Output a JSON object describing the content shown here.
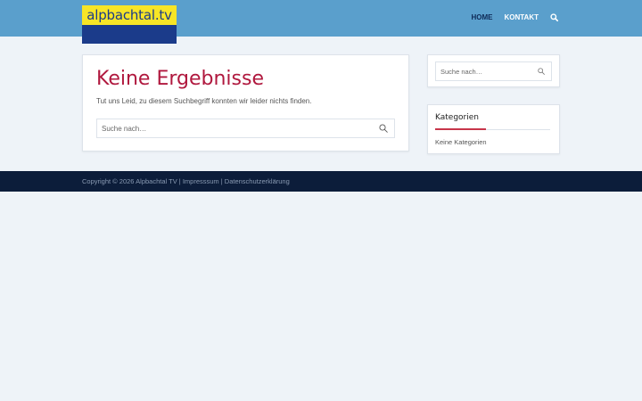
{
  "logo": {
    "text": "alpbachtal.tv"
  },
  "nav": {
    "home": "HOME",
    "kontakt": "KONTAKT"
  },
  "main": {
    "title": "Keine Ergebnisse",
    "description": "Tut uns Leid, zu diesem Suchbegriff konnten wir leider nichts finden.",
    "search_placeholder": "Suche nach…"
  },
  "sidebar": {
    "search_placeholder": "Suche nach…",
    "categories_title": "Kategorien",
    "categories_empty": "Keine Kategorien"
  },
  "footer": {
    "copyright": "Copyright © 2026 Alpbachtal TV",
    "sep1": " | ",
    "impressum": "Impresssum",
    "sep2": " | ",
    "datenschutz": "Datenschutzerklärung"
  },
  "colors": {
    "header": "#5a9fcc",
    "logo_yellow": "#f7e526",
    "logo_blue": "#1b3b8a",
    "title": "#b0183e",
    "footer": "#0c1d3a",
    "accent": "#c7354a"
  },
  "icons": {
    "nav_search": "search-icon",
    "main_search": "search-icon",
    "sidebar_search": "search-icon"
  }
}
